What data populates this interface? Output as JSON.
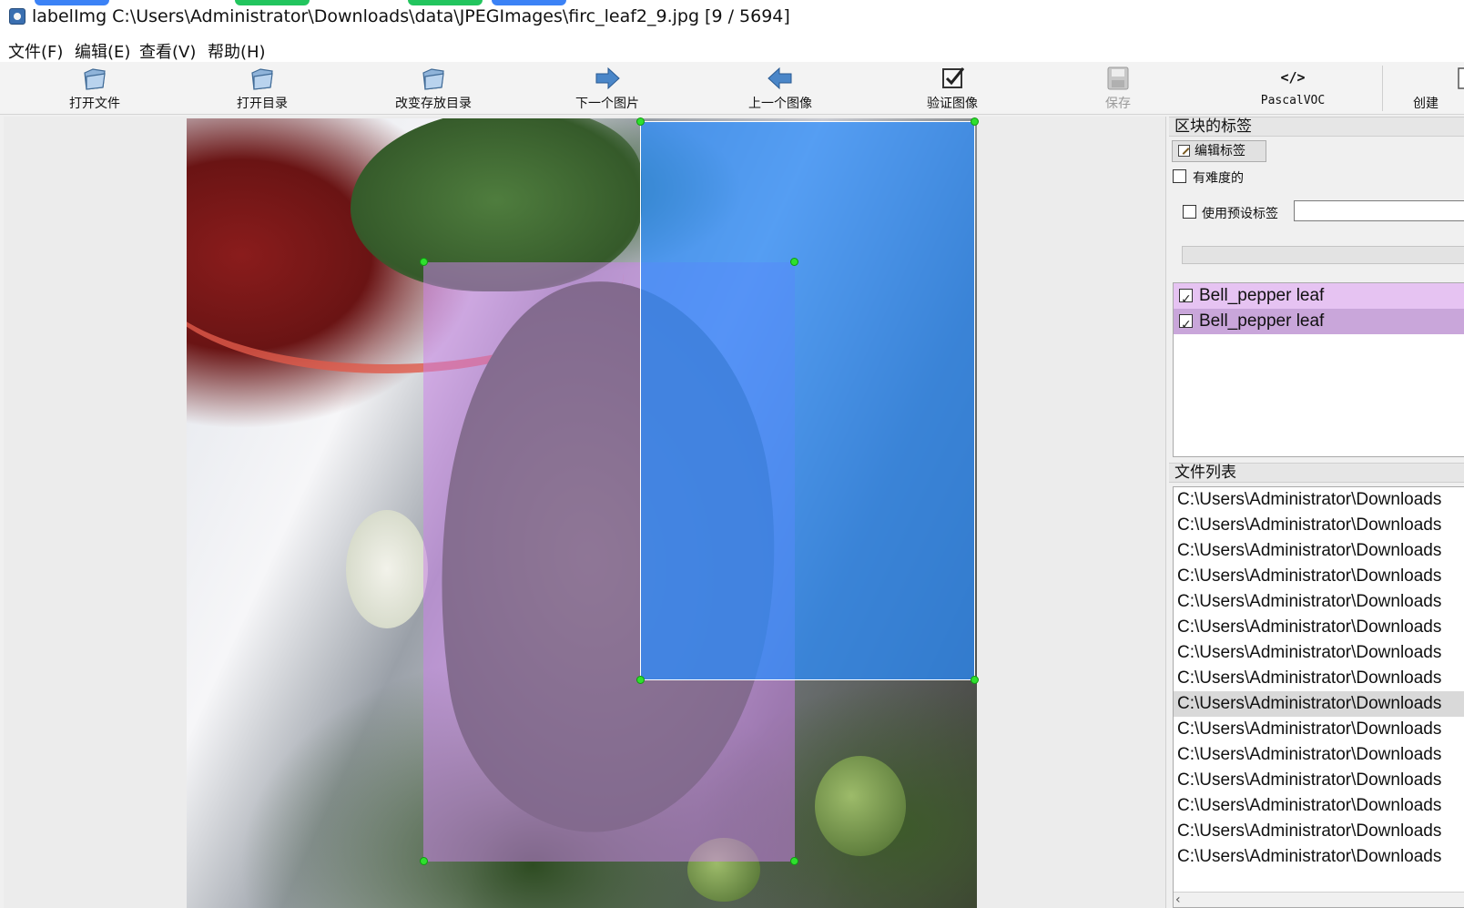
{
  "window": {
    "title": "labelImg C:\\Users\\Administrator\\Downloads\\data\\JPEGImages\\firc_leaf2_9.jpg [9 / 5694]",
    "app_icon": "labelimg-app-icon"
  },
  "menu": {
    "items": [
      {
        "label": "文件(F)"
      },
      {
        "label": "编辑(E)"
      },
      {
        "label": "查看(V)"
      },
      {
        "label": "帮助(H)"
      }
    ]
  },
  "toolbar": {
    "items": [
      {
        "label": "打开文件",
        "icon": "open-folder-icon",
        "enabled": true
      },
      {
        "label": "打开目录",
        "icon": "open-dir-icon",
        "enabled": true
      },
      {
        "label": "改变存放目录",
        "icon": "change-dir-icon",
        "enabled": true
      },
      {
        "label": "下一个图片",
        "icon": "next-arrow-icon",
        "enabled": true
      },
      {
        "label": "上一个图像",
        "icon": "prev-arrow-icon",
        "enabled": true
      },
      {
        "label": "验证图像",
        "icon": "verify-check-icon",
        "enabled": true
      },
      {
        "label": "保存",
        "icon": "save-disk-icon",
        "enabled": false
      },
      {
        "label": "PascalVOC",
        "icon": "code-tag-icon",
        "enabled": true
      },
      {
        "label": "创建",
        "icon": "create-box-icon",
        "enabled": true
      }
    ],
    "format_icon_text": "</>"
  },
  "canvas": {
    "image": "firc_leaf2_9.jpg",
    "boxes": [
      {
        "label": "Bell_pepper leaf",
        "color": "#ce82ec"
      },
      {
        "label": "Bell_pepper leaf",
        "color": "#288cff"
      }
    ]
  },
  "labels_panel": {
    "title": "区块的标签",
    "edit_button": "编辑标签",
    "difficult_label": "有难度的",
    "difficult_checked": false,
    "use_default_label": "使用预设标签",
    "use_default_checked": false,
    "default_label_value": "",
    "labels": [
      {
        "text": "Bell_pepper leaf",
        "checked": true,
        "color": "#e6c3f2"
      },
      {
        "text": "Bell_pepper leaf",
        "checked": true,
        "color": "#c9a6da"
      }
    ]
  },
  "file_panel": {
    "title": "文件列表",
    "selected_index": 8,
    "files": [
      "C:\\Users\\Administrator\\Downloads",
      "C:\\Users\\Administrator\\Downloads",
      "C:\\Users\\Administrator\\Downloads",
      "C:\\Users\\Administrator\\Downloads",
      "C:\\Users\\Administrator\\Downloads",
      "C:\\Users\\Administrator\\Downloads",
      "C:\\Users\\Administrator\\Downloads",
      "C:\\Users\\Administrator\\Downloads",
      "C:\\Users\\Administrator\\Downloads",
      "C:\\Users\\Administrator\\Downloads",
      "C:\\Users\\Administrator\\Downloads",
      "C:\\Users\\Administrator\\Downloads",
      "C:\\Users\\Administrator\\Downloads",
      "C:\\Users\\Administrator\\Downloads",
      "C:\\Users\\Administrator\\Downloads"
    ]
  }
}
